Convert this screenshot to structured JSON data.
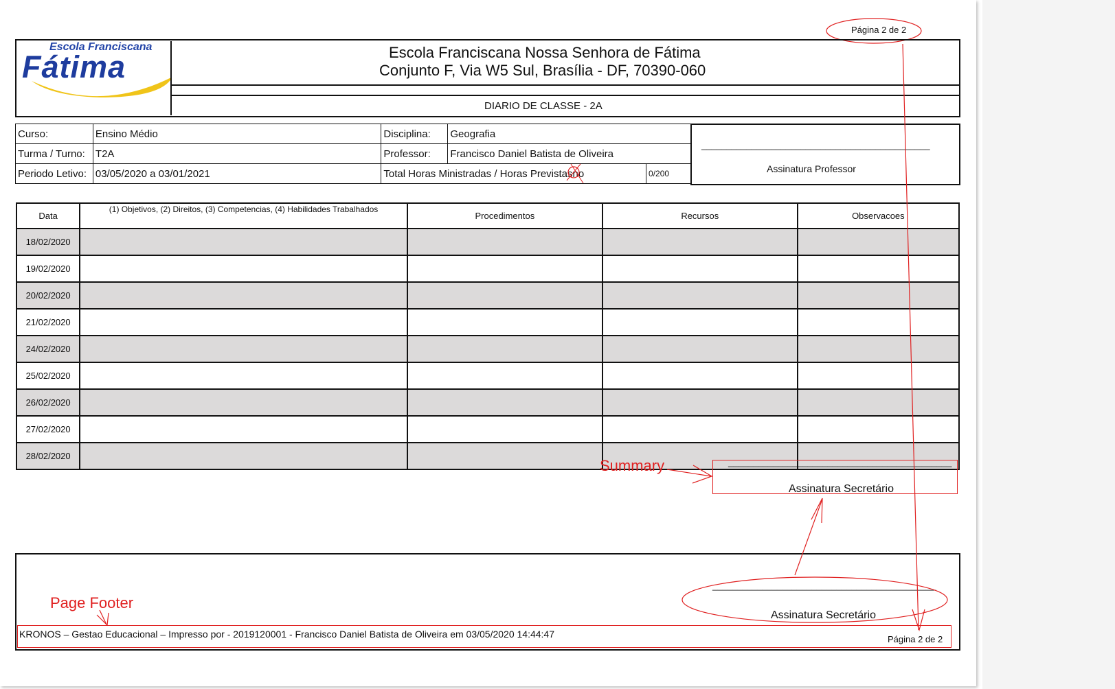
{
  "page_counter_top": "Página 2 de 2",
  "school": {
    "logo_top": "Escola Franciscana",
    "logo_main": "Fátima",
    "name": "Escola Franciscana Nossa Senhora de Fátima",
    "address": "Conjunto F, Via W5 Sul, Brasília - DF, 70390-060",
    "report_title": "DIARIO DE CLASSE - 2A"
  },
  "info": {
    "curso_label": "Curso:",
    "curso_value": "Ensino Médio",
    "disciplina_label": "Disciplina:",
    "disciplina_value": "Geografia",
    "turma_label": "Turma / Turno:",
    "turma_value": "T2A",
    "professor_label": "Professor:",
    "professor_value": "Francisco Daniel Batista de Oliveira",
    "periodo_label": "Periodo Letivo:",
    "periodo_value": "03/05/2020 a 03/01/2021",
    "horas_label": "Total Horas Ministradas / Horas Previstas",
    "horas_struck": "no",
    "horas_value": "0/200",
    "signature_line": "______________________________________________",
    "signature_professor": "Assinatura Professor"
  },
  "table": {
    "headers": [
      "Data",
      "(1) Objetivos, (2) Direitos, (3) Competencias, (4) Habilidades Trabalhados",
      "Procedimentos",
      "Recursos",
      "Observacoes"
    ],
    "dates": [
      "18/02/2020",
      "19/02/2020",
      "20/02/2020",
      "21/02/2020",
      "24/02/2020",
      "25/02/2020",
      "26/02/2020",
      "27/02/2020",
      "28/02/2020"
    ]
  },
  "summary": {
    "annotation": "Summary",
    "line": "_____________________________________________",
    "label": "Assinatura Secretário"
  },
  "footer": {
    "annotation": "Page Footer",
    "line": "_____________________________________________",
    "signature": "Assinatura Secretário",
    "printed_by": "KRONOS – Gestao Educacional – Impresso por - 2019120001 - Francisco Daniel Batista de Oliveira em 03/05/2020 14:44:47",
    "page_counter": "Página 2 de 2"
  },
  "colors": {
    "annotation": "#e02020",
    "shade": "#dcdada"
  }
}
